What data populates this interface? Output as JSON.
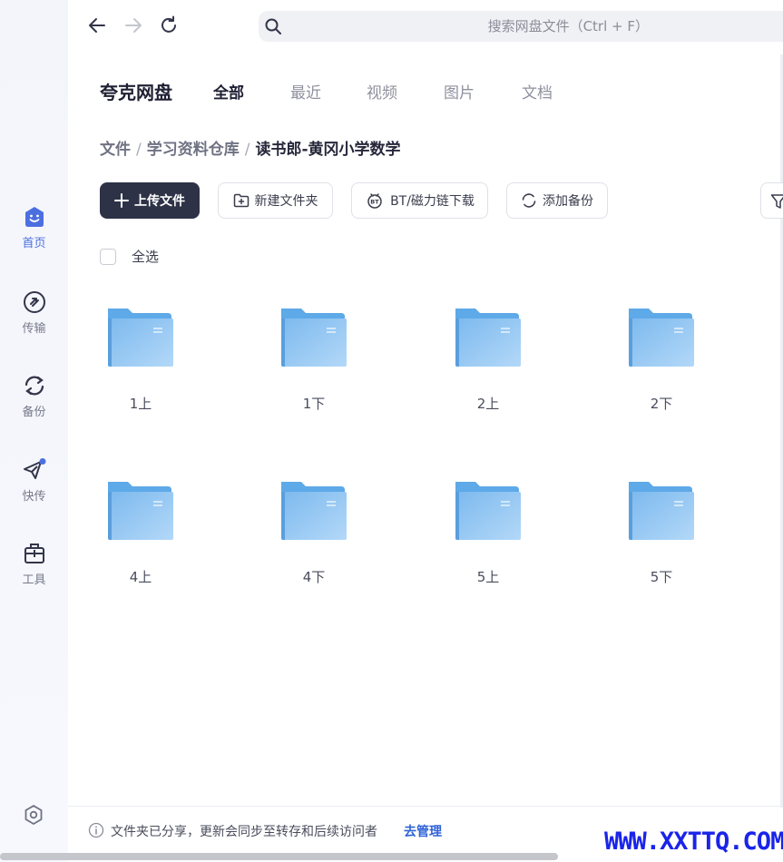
{
  "search": {
    "placeholder": "搜索网盘文件（Ctrl + F）"
  },
  "app": {
    "title": "夸克网盘"
  },
  "tabs": [
    {
      "label": "全部",
      "active": true
    },
    {
      "label": "最近",
      "active": false
    },
    {
      "label": "视频",
      "active": false
    },
    {
      "label": "图片",
      "active": false
    },
    {
      "label": "文档",
      "active": false
    }
  ],
  "breadcrumb": [
    {
      "label": "文件"
    },
    {
      "label": "学习资料仓库"
    },
    {
      "label": "读书郎-黄冈小学数学"
    }
  ],
  "breadcrumb_separator": "/",
  "toolbar": {
    "upload_label": "上传文件",
    "new_folder_label": "新建文件夹",
    "bt_download_label": "BT/磁力链下载",
    "add_backup_label": "添加备份"
  },
  "select_all_label": "全选",
  "folders": [
    {
      "name": "1上"
    },
    {
      "name": "1下"
    },
    {
      "name": "2上"
    },
    {
      "name": "2下"
    },
    {
      "name": "4上"
    },
    {
      "name": "4下"
    },
    {
      "name": "5上"
    },
    {
      "name": "5下"
    }
  ],
  "sidebar": {
    "items": [
      {
        "label": "首页",
        "icon": "home-icon",
        "active": true
      },
      {
        "label": "传输",
        "icon": "transfer-icon",
        "active": false
      },
      {
        "label": "备份",
        "icon": "backup-icon",
        "active": false
      },
      {
        "label": "快传",
        "icon": "quick-send-icon",
        "active": false
      },
      {
        "label": "工具",
        "icon": "toolbox-icon",
        "active": false
      }
    ]
  },
  "footer": {
    "message": "文件夹已分享，更新会同步至转存和后续访问者",
    "link_label": "去管理"
  },
  "watermark": "WWW.XXTTQ.COM",
  "colors": {
    "accent": "#4c6fe0",
    "primary_button": "#2e3247",
    "folder_blue": "#8ec4f2",
    "link": "#2f63d6",
    "watermark": "#1a24e8"
  }
}
